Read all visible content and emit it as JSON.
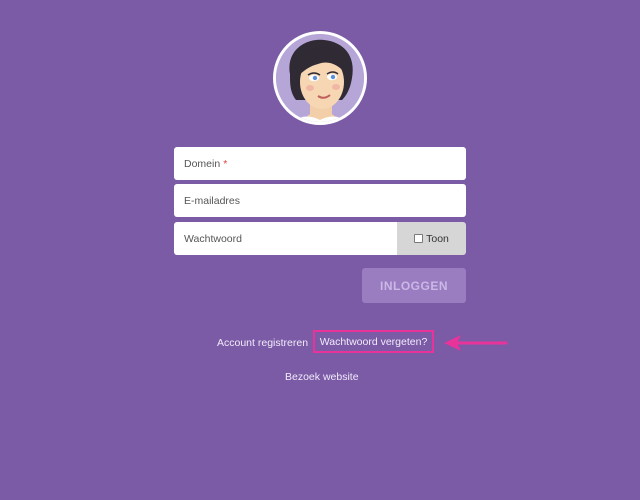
{
  "colors": {
    "background": "#7b5aa6",
    "button_bg": "#9a7cc0",
    "button_text": "#cbb8e6",
    "highlight": "#e8339a"
  },
  "avatar": {
    "icon": "user-avatar-illustration"
  },
  "form": {
    "domain_label": "Domein",
    "domain_required": "*",
    "email_label": "E-mailadres",
    "password_label": "Wachtwoord",
    "show_label": "Toon",
    "login_label": "INLOGGEN"
  },
  "links": {
    "register": "Account registreren",
    "forgot": "Wachtwoord vergeten?",
    "website": "Bezoek website"
  },
  "annotation": {
    "icon": "arrow-left-icon"
  }
}
